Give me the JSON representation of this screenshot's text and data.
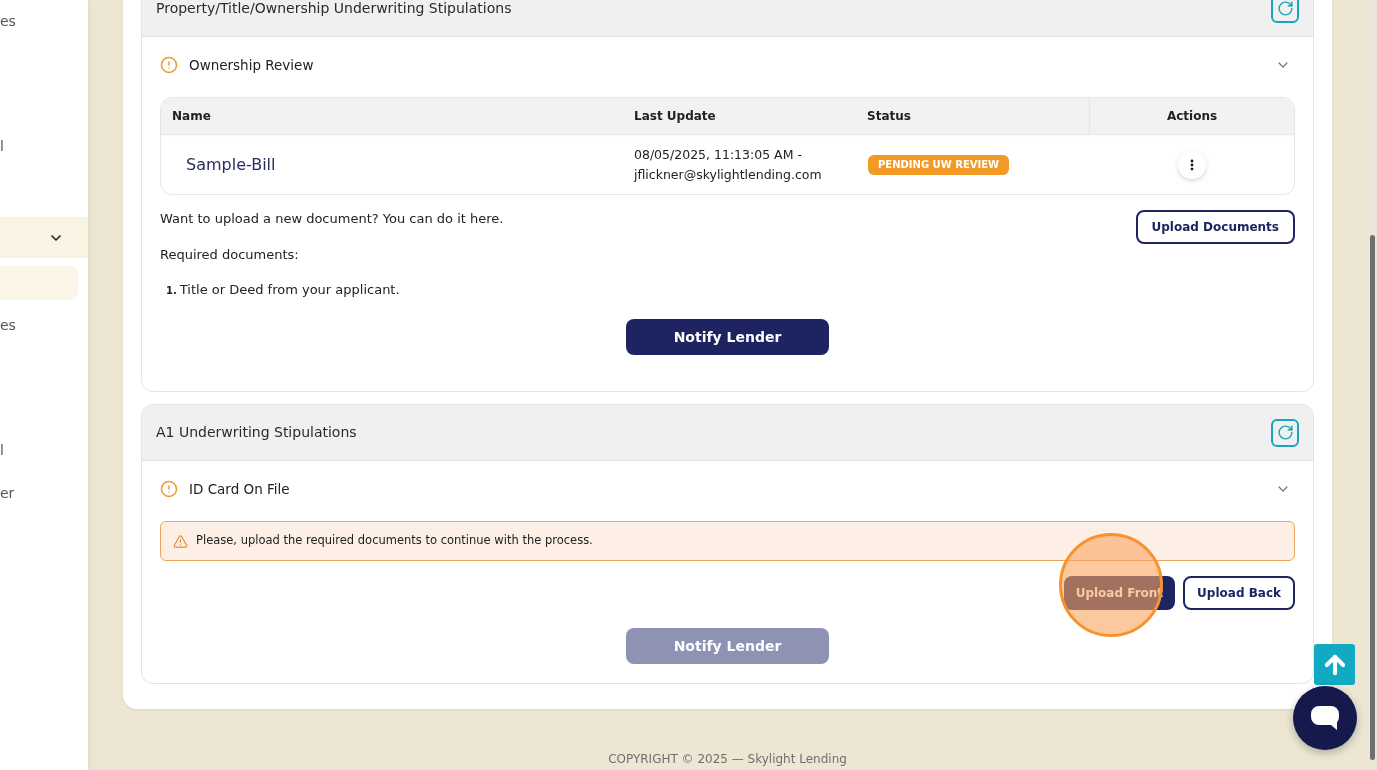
{
  "sidebar": {
    "items": [
      {
        "kind": "link",
        "label": "es",
        "selected": false
      },
      {
        "kind": "link",
        "label": "l",
        "selected": false
      },
      {
        "kind": "group",
        "expanded": true
      },
      {
        "kind": "link",
        "selected": true
      },
      {
        "kind": "link",
        "label": "es",
        "selected": false
      },
      {
        "kind": "link",
        "label": "l",
        "selected": false
      },
      {
        "kind": "link",
        "label": "er",
        "selected": false
      }
    ]
  },
  "sections": [
    {
      "title": "Property/Title/Ownership Underwriting Stipulations",
      "stipulations": [
        {
          "name": "Ownership Review",
          "expanded": true,
          "table": {
            "columns": [
              "Name",
              "Last Update",
              "Status",
              "Actions"
            ],
            "rows": [
              {
                "name": "Sample-Bill",
                "last_update": "08/05/2025, 11:13:05 AM - jflickner@skylightlending.com",
                "status": "PENDING UW REVIEW"
              }
            ]
          },
          "upload_prompt": "Want to upload a new document? You can do it here.",
          "upload_button": "Upload Documents",
          "required_label": "Required documents:",
          "required_documents": [
            {
              "marker": "1.",
              "text": "Title or Deed from your applicant."
            }
          ],
          "notify_button": {
            "label": "Notify Lender",
            "disabled": false
          }
        }
      ]
    },
    {
      "title": "A1 Underwriting Stipulations",
      "stipulations": [
        {
          "name": "ID Card On File",
          "expanded": true,
          "alert": "Please, upload the required documents to continue with the process.",
          "upload_buttons": [
            {
              "label": "Upload Front",
              "kind": "primary",
              "highlighted": true
            },
            {
              "label": "Upload Back",
              "kind": "outline",
              "highlighted": false
            }
          ],
          "notify_button": {
            "label": "Notify Lender",
            "disabled": true
          }
        }
      ]
    }
  ],
  "footer": "COPYRIGHT © 2025 — Skylight Lending"
}
